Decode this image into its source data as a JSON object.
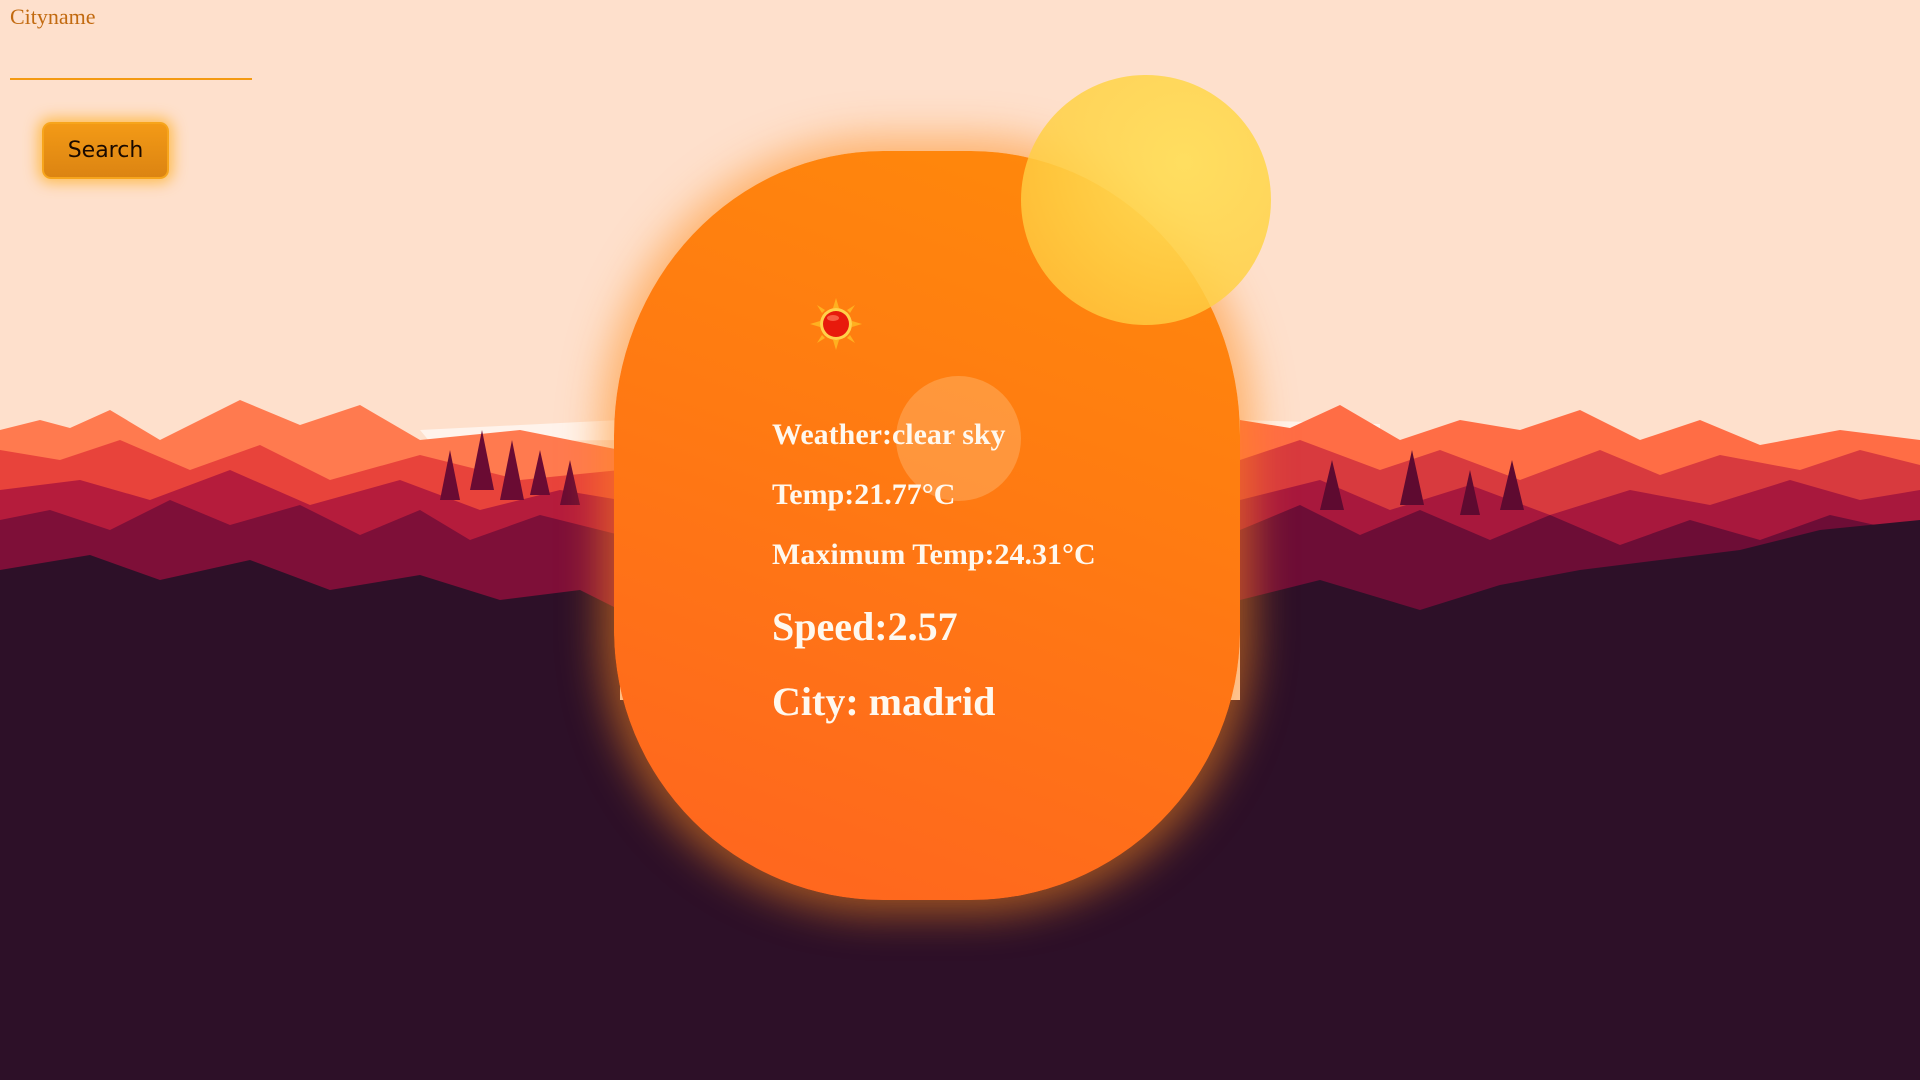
{
  "search": {
    "label": "Cityname",
    "input_value": "",
    "button_label": "Search"
  },
  "weather": {
    "description_line": "Weather:clear sky",
    "temp_line": "Temp:21.77°C",
    "max_temp_line": "Maximum Temp:24.31°C",
    "speed_line": "Speed:2.57",
    "city_line": "City: madrid",
    "icon": "sun-icon"
  },
  "colors": {
    "sky": "#fee0cc",
    "card": "#ff7a12",
    "accent": "#f49a12",
    "ground": "#2d1028"
  }
}
